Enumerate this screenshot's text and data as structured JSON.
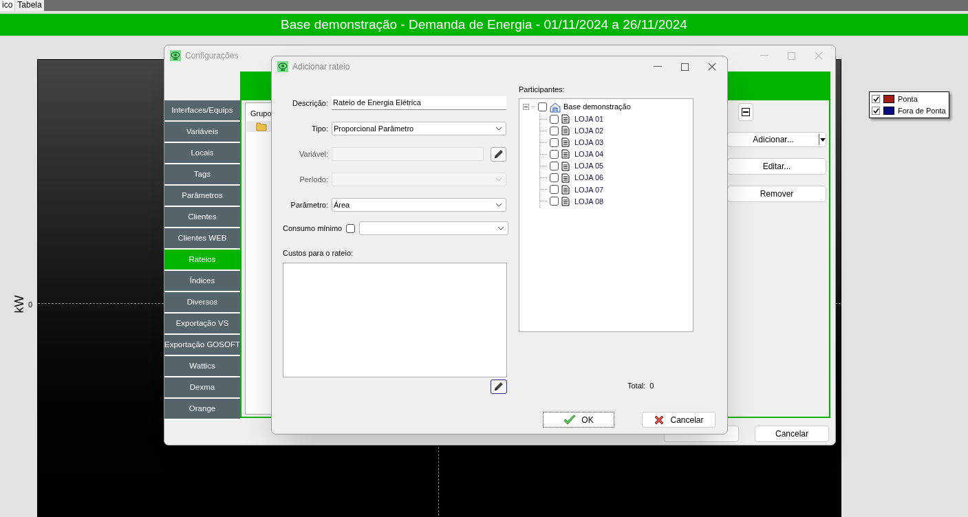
{
  "top_tabs": [
    {
      "label": "ico",
      "selected": true
    },
    {
      "label": "Tabela",
      "selected": false
    }
  ],
  "header": {
    "title": "Base demonstração - Demanda de Energia - 01/11/2024 a 26/11/2024"
  },
  "chart": {
    "ylabel": "kW",
    "ytick": "0"
  },
  "legend": [
    {
      "label": "Ponta",
      "checked": true,
      "color": "#a61b12"
    },
    {
      "label": "Fora de Ponta",
      "checked": true,
      "color": "#0b0b82"
    }
  ],
  "config_window": {
    "title": "Configurações",
    "nav": [
      {
        "label": "Interfaces/Equips",
        "selected": false
      },
      {
        "label": "Variáveis",
        "selected": false
      },
      {
        "label": "Locais",
        "selected": false
      },
      {
        "label": "Tags",
        "selected": false
      },
      {
        "label": "Parâmetros",
        "selected": false
      },
      {
        "label": "Clientes",
        "selected": false
      },
      {
        "label": "Clientes WEB",
        "selected": false
      },
      {
        "label": "Rateios",
        "selected": true
      },
      {
        "label": "Índices",
        "selected": false
      },
      {
        "label": "Diversos",
        "selected": false
      },
      {
        "label": "Exportação VS",
        "selected": false
      },
      {
        "label": "Exportação GOSOFT",
        "selected": false
      },
      {
        "label": "Wattics",
        "selected": false
      },
      {
        "label": "Dexma",
        "selected": false
      },
      {
        "label": "Orange",
        "selected": false
      }
    ],
    "tree_header": "Grupo",
    "buttons": [
      {
        "label": "Adicionar...",
        "kind": "split"
      },
      {
        "label": "Editar...",
        "kind": "plain"
      },
      {
        "label": "Remover",
        "kind": "plain"
      }
    ],
    "footer_button": "Cancelar"
  },
  "dialog": {
    "title": "Adicionar rateio",
    "fields": [
      {
        "label": "Descrição:",
        "kind": "text",
        "value": "Rateio de Energia Elétrica",
        "disabled": false
      },
      {
        "label": "Tipo:",
        "kind": "combo",
        "value": "Proporcional Parâmetro",
        "disabled": false
      },
      {
        "label": "Variável:",
        "kind": "picker",
        "disabled": true
      },
      {
        "label": "Período:",
        "kind": "combo",
        "disabled": true
      },
      {
        "label": "Parâmetro:",
        "kind": "combo",
        "value": "Área",
        "disabled": false
      },
      {
        "label": "Consumo mínimo",
        "kind": "check-combo",
        "checked": false,
        "disabled": false
      }
    ],
    "costs_label": "Custos para o rateio:",
    "participants_label": "Participantes:",
    "participants": [
      {
        "label": "Base demonstração",
        "checked": false,
        "expanded": true,
        "children": [
          {
            "label": "LOJA 01",
            "checked": false
          },
          {
            "label": "LOJA 02",
            "checked": false
          },
          {
            "label": "LOJA 03",
            "checked": false
          },
          {
            "label": "LOJA 04",
            "checked": false
          },
          {
            "label": "LOJA 05",
            "checked": false
          },
          {
            "label": "LOJA 06",
            "checked": false
          },
          {
            "label": "LOJA 07",
            "checked": false
          },
          {
            "label": "LOJA 08",
            "checked": false
          }
        ]
      }
    ],
    "total_label": "Total:",
    "total_value": "0",
    "ok_button": "OK",
    "cancel_button": "Cancelar"
  }
}
